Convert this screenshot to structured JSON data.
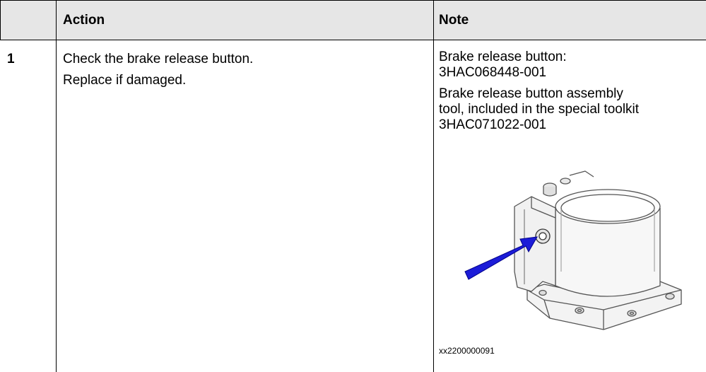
{
  "table": {
    "headers": {
      "blank": "",
      "action": "Action",
      "note": "Note"
    },
    "rows": [
      {
        "step": "1",
        "action_lines": [
          "Check the brake release button.",
          "Replace if damaged."
        ],
        "note_paragraphs": [
          [
            "Brake release button:",
            "3HAC068448-001"
          ],
          [
            "Brake release button assembly",
            "tool, included in the special toolkit",
            "3HAC071022-001"
          ]
        ],
        "figure_id": "xx2200000091"
      }
    ]
  },
  "colors": {
    "header_bg": "#e6e6e6",
    "arrow": "#1c1cd8",
    "border": "#000000"
  },
  "figure": {
    "subject": "brake-release-button-housing",
    "indicator": "blue-arrow-icon"
  }
}
